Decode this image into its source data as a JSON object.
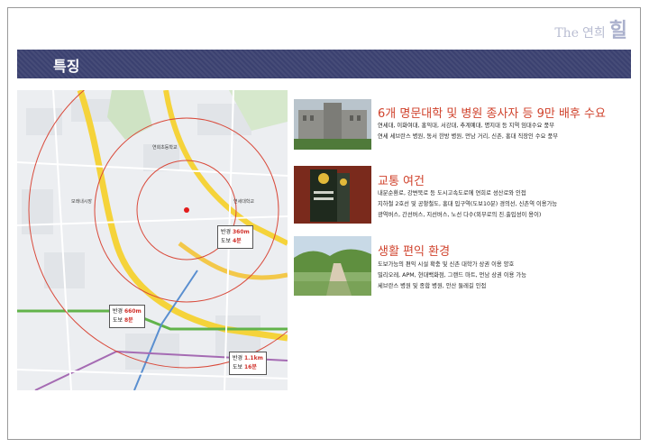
{
  "logo": {
    "small": "The",
    "brand": "연희",
    "big": "힐"
  },
  "banner": {
    "title": "특징"
  },
  "map": {
    "distances": [
      {
        "label1": "반경",
        "value1": "360m",
        "label2": "도보",
        "value2": "4분"
      },
      {
        "label1": "반경",
        "value1": "660m",
        "label2": "도보",
        "value2": "8분"
      },
      {
        "label1": "반경",
        "value1": "1.1km",
        "label2": "도보",
        "value2": "16분"
      }
    ]
  },
  "features": [
    {
      "title": "6개 명문대학 및 병원 종사자 등 9만 배후 수요",
      "lines": [
        "연세대, 이화여대, 홍익대, 서강대, 추계예대, 명지대 등 지역 임대수요 풍부",
        "연세 세브란스 병원, 동서 한방 병원, 먼남 거리, 신촌, 홍대 직장인 수요 풍부"
      ]
    },
    {
      "title": "교통 여건",
      "lines": [
        "내분순환로, 강변북로 등 도시고속도로에 연희로 성산로와 인접",
        "지하철 2호선 및 공항철도, 홍대 입구역(도보10분) 경의선, 신촌역 이용가능",
        "광역버스, 간선버스, 지선버스, 노선 다수(외부로의 진.출입성이 용이)"
      ]
    },
    {
      "title": "생활 편익 환경",
      "lines": [
        "도보가능의 편익 시설 확충 및 신촌 대학가 상권 이용 양호",
        "밀리오레, APM, 현대백화점, 그랜드 마트, 먼남 상권 이용 가능",
        "세브란스 병원 및 종합 병원, 안산 둘레길 인접"
      ]
    }
  ]
}
